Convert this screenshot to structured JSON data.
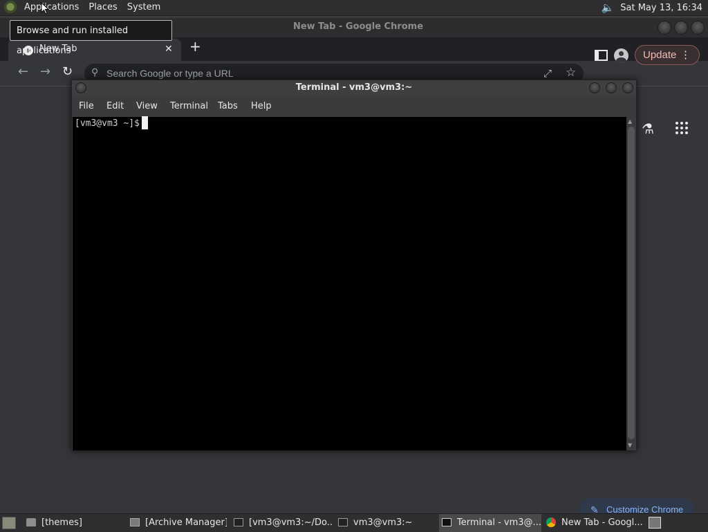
{
  "top_panel": {
    "menu": [
      "Applications",
      "Places",
      "System"
    ],
    "clock": "Sat May 13, 16:34"
  },
  "tooltip": "Browse and run installed applications",
  "chrome": {
    "window_title": "New Tab - Google Chrome",
    "tab_title": "New Tab",
    "omnibox_placeholder": "Search Google or type a URL",
    "update_label": "Update",
    "customize_label": "Customize Chrome"
  },
  "terminal": {
    "title": "Terminal - vm3@vm3:~",
    "menu": [
      "File",
      "Edit",
      "View",
      "Terminal",
      "Tabs",
      "Help"
    ],
    "prompt": "[vm3@vm3 ~]$"
  },
  "taskbar": {
    "tasks": [
      {
        "label": "[themes]"
      },
      {
        "label": "[Archive Manager]"
      },
      {
        "label": "[vm3@vm3:~/Do..."
      },
      {
        "label": "vm3@vm3:~"
      },
      {
        "label": "Terminal - vm3@..."
      },
      {
        "label": "New Tab - Googl..."
      }
    ]
  }
}
